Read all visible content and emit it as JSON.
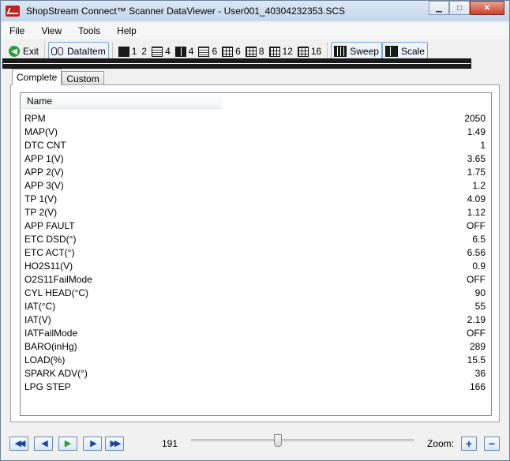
{
  "window": {
    "title": "ShopStream Connect™ Scanner DataViewer - User001_40304232353.SCS",
    "controls": {
      "minimize": "▁",
      "maximize": "□",
      "close": "✕"
    }
  },
  "menu": [
    "File",
    "View",
    "Tools",
    "Help"
  ],
  "toolbar": {
    "exit": "Exit",
    "dataitem": "DataItem",
    "layouts": [
      "1",
      "2",
      "4",
      "4",
      "6",
      "6",
      "8",
      "12",
      "16"
    ],
    "sweep": "Sweep",
    "scale": "Scale"
  },
  "tabs": [
    {
      "label": "Complete",
      "active": true
    },
    {
      "label": "Custom",
      "active": false
    }
  ],
  "table": {
    "column_header": "Name",
    "rows": [
      {
        "name": "RPM",
        "value": "2050"
      },
      {
        "name": "MAP(V)",
        "value": "1.49"
      },
      {
        "name": "DTC CNT",
        "value": "1"
      },
      {
        "name": "APP 1(V)",
        "value": "3.65"
      },
      {
        "name": "APP 2(V)",
        "value": "1.75"
      },
      {
        "name": "APP 3(V)",
        "value": "1.2"
      },
      {
        "name": "TP 1(V)",
        "value": "4.09"
      },
      {
        "name": "TP 2(V)",
        "value": "1.12"
      },
      {
        "name": "APP FAULT",
        "value": "OFF"
      },
      {
        "name": "ETC DSD(°)",
        "value": "6.5"
      },
      {
        "name": "ETC ACT(°)",
        "value": "6.56"
      },
      {
        "name": "HO2S11(V)",
        "value": "0.9"
      },
      {
        "name": "O2S11FailMode",
        "value": "OFF"
      },
      {
        "name": "CYL HEAD(°C)",
        "value": "90"
      },
      {
        "name": "IAT(°C)",
        "value": "55"
      },
      {
        "name": "IAT(V)",
        "value": "2.19"
      },
      {
        "name": "IATFailMode",
        "value": "OFF"
      },
      {
        "name": "BARO(inHg)",
        "value": "289"
      },
      {
        "name": "LOAD(%)",
        "value": "15.5"
      },
      {
        "name": "SPARK ADV(°)",
        "value": "36"
      },
      {
        "name": "LPG STEP",
        "value": "166"
      }
    ]
  },
  "playback": {
    "frame": "191",
    "position_fraction": 0.39,
    "zoom_label": "Zoom:",
    "zoom_in": "+",
    "zoom_out": "−"
  }
}
